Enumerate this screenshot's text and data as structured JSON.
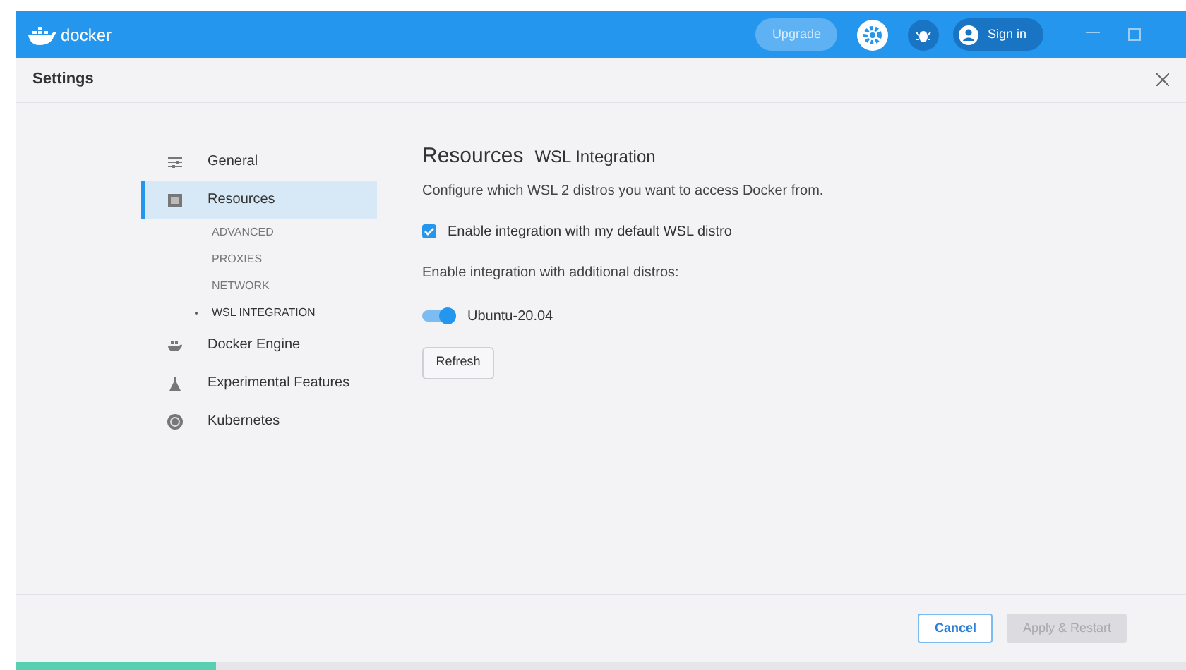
{
  "header": {
    "logo": "docker",
    "upgrade": "Upgrade",
    "sign_in": "Sign in"
  },
  "settings": {
    "title": "Settings"
  },
  "nav": [
    {
      "label": "General",
      "selected": false
    },
    {
      "label": "Resources",
      "selected": true,
      "children": [
        {
          "label": "ADVANCED",
          "selected": false
        },
        {
          "label": "PROXIES",
          "selected": false
        },
        {
          "label": "NETWORK",
          "selected": false
        },
        {
          "label": "WSL INTEGRATION",
          "selected": true
        }
      ]
    },
    {
      "label": "Docker Engine",
      "selected": false
    },
    {
      "label": "Experimental Features",
      "selected": false
    },
    {
      "label": "Kubernetes",
      "selected": false
    }
  ],
  "content": {
    "title": "Resources",
    "subtitle": "WSL Integration",
    "description": "Configure which WSL 2 distros you want to access Docker from.",
    "default_integration": {
      "label": "Enable integration with my default WSL distro",
      "checked": true
    },
    "additional_label": "Enable integration with additional distros:",
    "distros": [
      {
        "name": "Ubuntu-20.04",
        "on": true
      }
    ],
    "refresh": "Refresh"
  },
  "footer": [
    {
      "label": "Cancel",
      "disabled": false
    },
    {
      "label": "Apply & Restart",
      "disabled": true
    }
  ]
}
